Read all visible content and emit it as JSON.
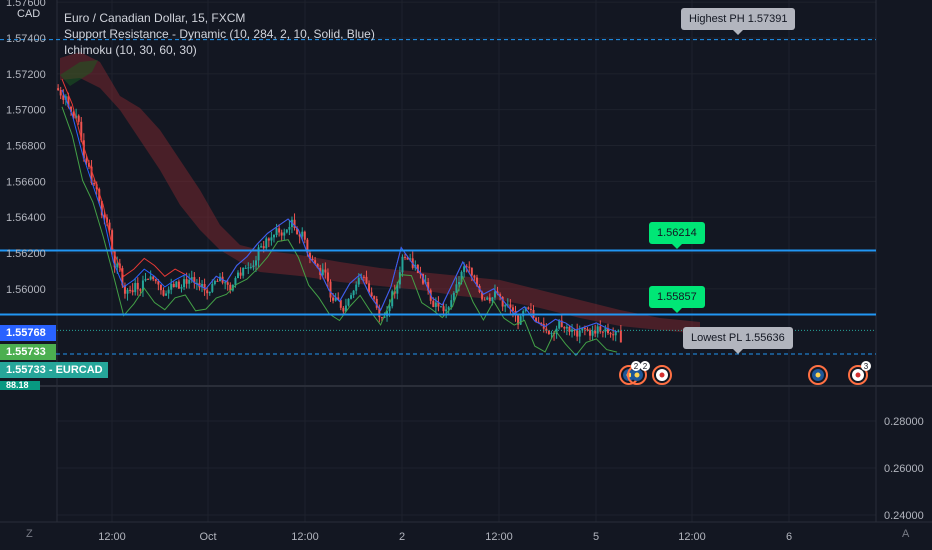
{
  "legend": {
    "title": "Euro / Canadian Dollar, 15, FXCM",
    "indicator1": "Support Resistance - Dynamic (10, 284, 2, 10, Solid, Blue)",
    "indicator2": "Ichimoku (10, 30, 60, 30)"
  },
  "currency_label": "CAD",
  "price_axis_ticks": [
    "1.57600",
    "1.57400",
    "1.57200",
    "1.57000",
    "1.56800",
    "1.56600",
    "1.56400",
    "1.56200",
    "1.56000"
  ],
  "lower_axis_ticks": [
    "0.28000",
    "0.26000",
    "0.24000"
  ],
  "time_axis_ticks": [
    "12:00",
    "Oct",
    "12:00",
    "2",
    "12:00",
    "5",
    "12:00",
    "6"
  ],
  "price_tags": {
    "tag1": "1.55768",
    "tag2": "1.55733",
    "tag3_value": "1.55733",
    "tag3_symbol": "EURCAD",
    "tag4": "88.18"
  },
  "callouts": {
    "highest": "Highest PH 1.57391",
    "resistance": "1.56214",
    "support": "1.55857",
    "lowest": "Lowest PL 1.55636"
  },
  "events": {
    "badge1": "2",
    "badge2": "2",
    "badge3": "3"
  },
  "buttons": {
    "zoom_label": "Z",
    "auto_label": "A"
  },
  "colors": {
    "background": "#131722",
    "candle_up": "#26a69a",
    "candle_down": "#ef5350",
    "sr_line": "#2196f3",
    "cloud": "#8b2a31",
    "tenkan": "#2962ff",
    "kijun": "#e53935",
    "chikou": "#43a047"
  },
  "chart_data": {
    "type": "line",
    "symbol": "EURCAD",
    "interval": "15",
    "ylim": [
      1.5555,
      1.5775
    ],
    "levels": {
      "highest_ph": 1.57391,
      "resistance": 1.56214,
      "support": 1.55857,
      "lowest_pl": 1.55636,
      "last_price": 1.55733,
      "bid_line": 1.55768
    },
    "close_series": [
      1.5708,
      1.5694,
      1.5672,
      1.5655,
      1.5638,
      1.5612,
      1.5598,
      1.5602,
      1.5608,
      1.5604,
      1.5598,
      1.5602,
      1.5605,
      1.56,
      1.5597,
      1.5604,
      1.5601,
      1.561,
      1.5615,
      1.5622,
      1.5628,
      1.5632,
      1.5636,
      1.563,
      1.5615,
      1.5608,
      1.5596,
      1.559,
      1.56,
      1.5605,
      1.5593,
      1.5585,
      1.5598,
      1.562,
      1.5612,
      1.5605,
      1.5592,
      1.5588,
      1.56,
      1.5612,
      1.5602,
      1.5594,
      1.5597,
      1.559,
      1.5583,
      1.5587,
      1.5579,
      1.5576,
      1.558,
      1.5578,
      1.5574,
      1.5576,
      1.5578,
      1.5575,
      1.5573
    ],
    "indicator_values": [
      0.28,
      0.26,
      0.24
    ]
  }
}
